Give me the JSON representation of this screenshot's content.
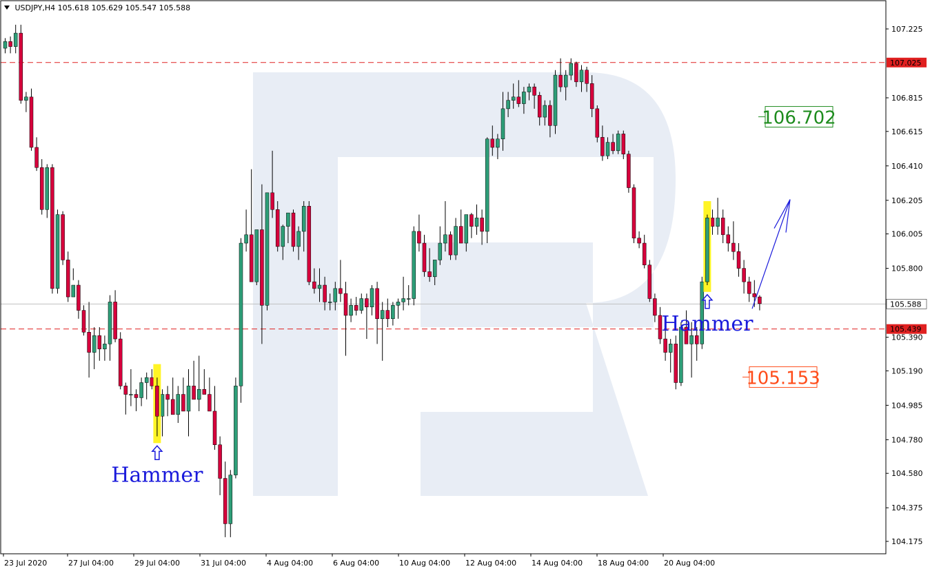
{
  "header": {
    "symbol": "USDJPY,H4",
    "ohlc": "105.618 105.629 105.547 105.588"
  },
  "colors": {
    "bull": "#2e9e78",
    "bear": "#d6003c",
    "wick": "#000000",
    "level_line": "#e02020",
    "highlight": "#fff200",
    "watermark": "#e8edf5",
    "annotation": "#1a1adb",
    "target_up": "#1e8c1e",
    "target_down": "#ff4c1a"
  },
  "chart_data": {
    "type": "candlestick",
    "ylim": [
      104.1,
      107.35
    ],
    "y_ticks": [
      "107.225",
      "106.815",
      "106.615",
      "106.410",
      "106.205",
      "106.005",
      "105.800",
      "105.390",
      "105.190",
      "104.985",
      "104.780",
      "104.580",
      "104.375",
      "104.175"
    ],
    "x_ticks": [
      "23 Jul 2020",
      "27 Jul 04:00",
      "29 Jul 04:00",
      "31 Jul 04:00",
      "4 Aug 04:00",
      "6 Aug 04:00",
      "10 Aug 04:00",
      "12 Aug 04:00",
      "14 Aug 04:00",
      "18 Aug 04:00",
      "20 Aug 04:00"
    ],
    "levels": [
      {
        "label": "107.025",
        "value": 107.025,
        "style": "dashed"
      },
      {
        "label": "105.439",
        "value": 105.439,
        "style": "dashed"
      }
    ],
    "current_price": {
      "label": "105.588",
      "value": 105.588
    },
    "targets": [
      {
        "label": "106.702",
        "value": 106.702,
        "kind": "up"
      },
      {
        "label": "105.153",
        "value": 105.153,
        "kind": "down"
      }
    ],
    "annotations": [
      {
        "text": "Hammer",
        "candle_index": 29
      },
      {
        "text": "Hammer",
        "candle_index": 134
      }
    ],
    "forecast_arrow": {
      "from": 105.56,
      "to": 106.21
    },
    "candles": [
      [
        107.11,
        107.17,
        107.08,
        107.15
      ],
      [
        107.15,
        107.18,
        107.08,
        107.12
      ],
      [
        107.12,
        107.25,
        107.08,
        107.2
      ],
      [
        107.2,
        107.25,
        106.78,
        106.8
      ],
      [
        106.8,
        106.85,
        106.73,
        106.82
      ],
      [
        106.82,
        106.87,
        106.5,
        106.52
      ],
      [
        106.52,
        106.58,
        106.38,
        106.4
      ],
      [
        106.4,
        106.45,
        106.12,
        106.15
      ],
      [
        106.15,
        106.42,
        106.1,
        106.4
      ],
      [
        106.4,
        106.42,
        105.65,
        105.68
      ],
      [
        105.68,
        106.15,
        105.65,
        106.12
      ],
      [
        106.12,
        106.14,
        105.82,
        105.85
      ],
      [
        105.85,
        105.9,
        105.6,
        105.63
      ],
      [
        105.63,
        105.73,
        105.8,
        105.7
      ],
      [
        105.7,
        105.73,
        105.5,
        105.55
      ],
      [
        105.55,
        105.58,
        105.4,
        105.42
      ],
      [
        105.42,
        105.6,
        105.15,
        105.3
      ],
      [
        105.3,
        105.45,
        105.2,
        105.4
      ],
      [
        105.4,
        105.45,
        105.25,
        105.32
      ],
      [
        105.32,
        105.4,
        105.25,
        105.35
      ],
      [
        105.35,
        105.64,
        105.25,
        105.6
      ],
      [
        105.6,
        105.67,
        105.36,
        105.38
      ],
      [
        105.38,
        105.42,
        105.08,
        105.1
      ],
      [
        105.1,
        105.12,
        104.93,
        105.05
      ],
      [
        105.05,
        105.2,
        104.98,
        105.05
      ],
      [
        105.05,
        105.08,
        104.95,
        105.03
      ],
      [
        105.03,
        105.15,
        104.98,
        105.12
      ],
      [
        105.12,
        105.18,
        105.02,
        105.15
      ],
      [
        105.15,
        105.2,
        105.08,
        105.1
      ],
      [
        105.1,
        105.15,
        104.8,
        104.92
      ],
      [
        104.92,
        105.08,
        104.8,
        105.05
      ],
      [
        105.05,
        105.1,
        104.92,
        105.02
      ],
      [
        105.02,
        105.15,
        104.98,
        104.93
      ],
      [
        104.93,
        105.1,
        104.88,
        105.05
      ],
      [
        105.05,
        105.15,
        105.0,
        104.95
      ],
      [
        104.95,
        105.2,
        104.8,
        105.1
      ],
      [
        105.1,
        105.25,
        105.08,
        105.02
      ],
      [
        105.02,
        105.28,
        104.95,
        105.08
      ],
      [
        105.08,
        105.2,
        105.05,
        105.05
      ],
      [
        105.05,
        105.15,
        104.95,
        104.95
      ],
      [
        104.95,
        105.1,
        104.72,
        104.75
      ],
      [
        104.75,
        104.8,
        104.45,
        104.55
      ],
      [
        104.55,
        104.65,
        104.2,
        104.28
      ],
      [
        104.28,
        104.6,
        104.2,
        104.57
      ],
      [
        104.57,
        105.15,
        104.55,
        105.1
      ],
      [
        105.1,
        105.98,
        105.0,
        105.95
      ],
      [
        105.95,
        106.15,
        105.9,
        106.0
      ],
      [
        106.0,
        106.39,
        105.95,
        105.72
      ],
      [
        105.72,
        105.95,
        105.7,
        106.03
      ],
      [
        106.03,
        106.3,
        105.35,
        105.58
      ],
      [
        105.58,
        106.25,
        105.55,
        106.25
      ],
      [
        106.25,
        106.5,
        106.1,
        106.15
      ],
      [
        106.15,
        106.2,
        105.9,
        105.93
      ],
      [
        105.93,
        106.06,
        105.85,
        106.05
      ],
      [
        106.05,
        106.1,
        105.95,
        106.13
      ],
      [
        106.13,
        106.15,
        105.9,
        105.93
      ],
      [
        105.93,
        106.05,
        105.85,
        106.02
      ],
      [
        106.02,
        106.2,
        105.9,
        106.17
      ],
      [
        106.17,
        106.2,
        105.7,
        105.72
      ],
      [
        105.72,
        105.8,
        105.65,
        105.68
      ],
      [
        105.68,
        105.8,
        105.6,
        105.7
      ],
      [
        105.7,
        105.75,
        105.55,
        105.6
      ],
      [
        105.6,
        105.65,
        105.55,
        105.6
      ],
      [
        105.6,
        105.72,
        105.55,
        105.68
      ],
      [
        105.68,
        105.85,
        105.6,
        105.65
      ],
      [
        105.65,
        105.72,
        105.28,
        105.52
      ],
      [
        105.52,
        105.62,
        105.48,
        105.58
      ],
      [
        105.58,
        105.63,
        105.52,
        105.55
      ],
      [
        105.55,
        105.65,
        105.53,
        105.62
      ],
      [
        105.62,
        105.65,
        105.38,
        105.57
      ],
      [
        105.57,
        105.7,
        105.52,
        105.68
      ],
      [
        105.68,
        105.72,
        105.35,
        105.5
      ],
      [
        105.5,
        105.6,
        105.25,
        105.55
      ],
      [
        105.55,
        105.62,
        105.45,
        105.5
      ],
      [
        105.5,
        105.6,
        105.46,
        105.58
      ],
      [
        105.58,
        105.62,
        105.5,
        105.6
      ],
      [
        105.6,
        105.75,
        105.55,
        105.62
      ],
      [
        105.62,
        105.7,
        105.58,
        105.62
      ],
      [
        105.62,
        106.05,
        105.58,
        106.02
      ],
      [
        106.02,
        106.12,
        105.9,
        105.95
      ],
      [
        105.95,
        106.0,
        105.75,
        105.78
      ],
      [
        105.78,
        105.92,
        105.72,
        105.75
      ],
      [
        105.75,
        105.85,
        105.7,
        105.85
      ],
      [
        105.85,
        106.05,
        105.82,
        105.95
      ],
      [
        105.95,
        106.2,
        105.9,
        106.0
      ],
      [
        106.0,
        106.02,
        105.85,
        105.88
      ],
      [
        105.88,
        106.1,
        105.85,
        106.05
      ],
      [
        106.05,
        106.15,
        105.95,
        105.95
      ],
      [
        105.95,
        106.12,
        105.9,
        106.12
      ],
      [
        106.12,
        106.13,
        105.98,
        106.05
      ],
      [
        106.05,
        106.18,
        106.0,
        106.1
      ],
      [
        106.1,
        106.15,
        105.94,
        106.02
      ],
      [
        106.02,
        106.58,
        105.95,
        106.57
      ],
      [
        106.57,
        106.65,
        106.47,
        106.52
      ],
      [
        106.52,
        106.6,
        106.45,
        106.57
      ],
      [
        106.57,
        106.85,
        106.5,
        106.75
      ],
      [
        106.75,
        106.85,
        106.7,
        106.8
      ],
      [
        106.8,
        106.9,
        106.75,
        106.82
      ],
      [
        106.82,
        106.92,
        106.76,
        106.78
      ],
      [
        106.78,
        106.88,
        106.72,
        106.85
      ],
      [
        106.85,
        106.9,
        106.8,
        106.88
      ],
      [
        106.88,
        106.9,
        106.75,
        106.83
      ],
      [
        106.83,
        106.85,
        106.65,
        106.7
      ],
      [
        106.7,
        106.8,
        106.65,
        106.77
      ],
      [
        106.77,
        106.8,
        106.58,
        106.65
      ],
      [
        106.65,
        106.98,
        106.6,
        106.95
      ],
      [
        106.95,
        107.05,
        106.85,
        106.88
      ],
      [
        106.88,
        106.98,
        106.8,
        106.95
      ],
      [
        106.95,
        107.05,
        106.92,
        107.02
      ],
      [
        107.02,
        107.03,
        106.88,
        106.91
      ],
      [
        106.91,
        107.01,
        106.85,
        106.98
      ],
      [
        106.98,
        107.0,
        106.85,
        106.9
      ],
      [
        106.9,
        106.95,
        106.7,
        106.75
      ],
      [
        106.75,
        106.77,
        106.55,
        106.58
      ],
      [
        106.58,
        106.65,
        106.44,
        106.47
      ],
      [
        106.47,
        106.58,
        106.45,
        106.55
      ],
      [
        106.55,
        106.6,
        106.48,
        106.5
      ],
      [
        106.5,
        106.62,
        106.48,
        106.6
      ],
      [
        106.6,
        106.62,
        106.45,
        106.48
      ],
      [
        106.48,
        106.5,
        106.25,
        106.28
      ],
      [
        106.28,
        106.3,
        105.95,
        105.98
      ],
      [
        105.98,
        106.02,
        105.92,
        105.95
      ],
      [
        105.95,
        106.0,
        105.8,
        105.82
      ],
      [
        105.82,
        105.85,
        105.6,
        105.62
      ],
      [
        105.62,
        105.65,
        105.48,
        105.52
      ],
      [
        105.52,
        105.57,
        105.35,
        105.38
      ],
      [
        105.38,
        105.5,
        105.25,
        105.3
      ],
      [
        105.3,
        105.38,
        105.18,
        105.35
      ],
      [
        105.35,
        105.4,
        105.08,
        105.12
      ],
      [
        105.12,
        105.48,
        105.1,
        105.45
      ],
      [
        105.45,
        105.55,
        105.38,
        105.35
      ],
      [
        105.35,
        105.48,
        105.15,
        105.4
      ],
      [
        105.4,
        105.45,
        105.25,
        105.35
      ],
      [
        105.35,
        105.75,
        105.32,
        105.72
      ],
      [
        105.72,
        106.12,
        105.7,
        106.1
      ],
      [
        106.1,
        106.15,
        106.0,
        106.05
      ],
      [
        106.05,
        106.22,
        106.0,
        106.1
      ],
      [
        106.1,
        106.15,
        105.95,
        106.0
      ],
      [
        106.0,
        106.05,
        105.9,
        105.95
      ],
      [
        105.95,
        106.08,
        105.85,
        105.9
      ],
      [
        105.9,
        105.95,
        105.75,
        105.8
      ],
      [
        105.8,
        105.85,
        105.65,
        105.72
      ],
      [
        105.72,
        105.75,
        105.6,
        105.65
      ],
      [
        105.65,
        105.73,
        105.57,
        105.63
      ],
      [
        105.63,
        105.64,
        105.55,
        105.59
      ]
    ]
  }
}
